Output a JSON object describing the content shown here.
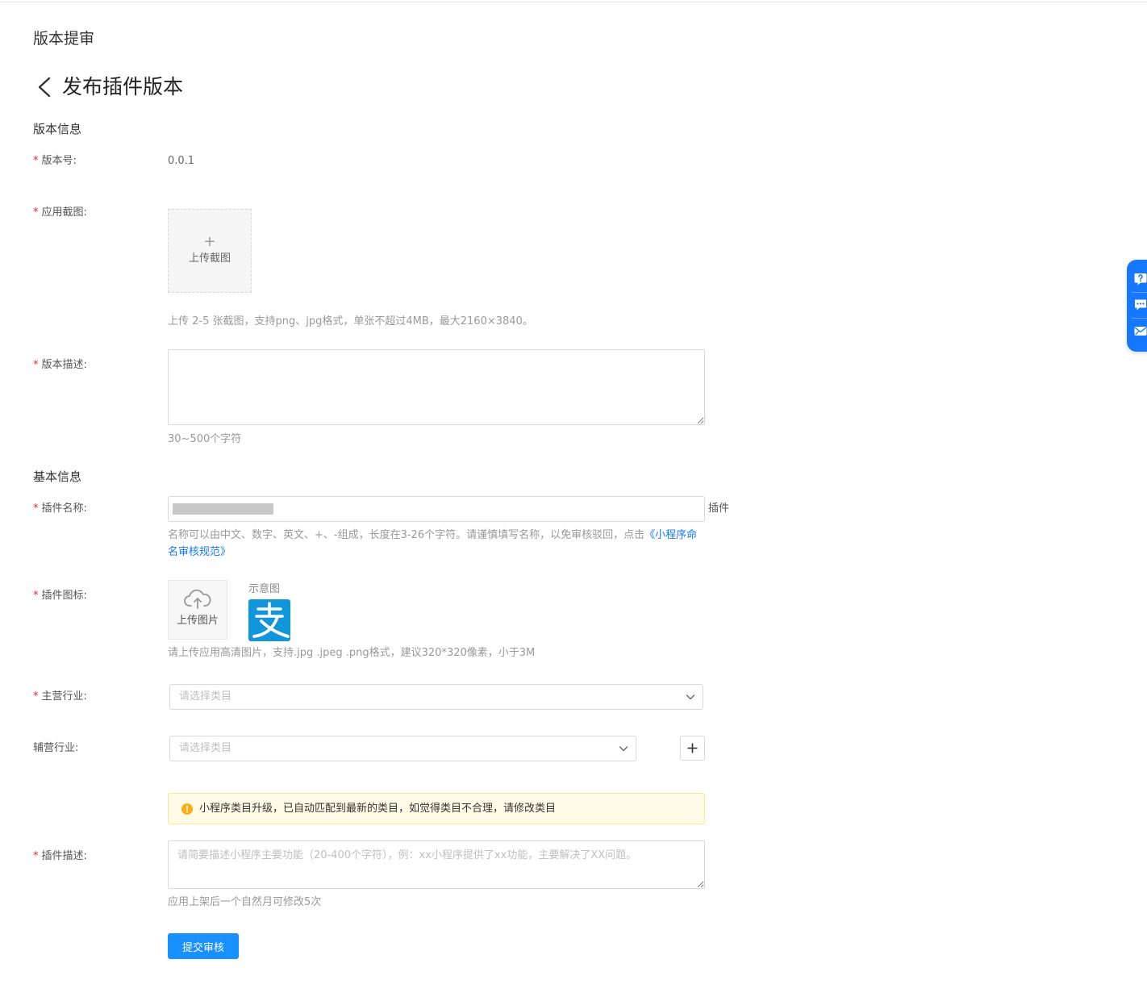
{
  "page": {
    "title": "版本提审",
    "subtitle": "发布插件版本"
  },
  "version_info": {
    "section_title": "版本信息",
    "version_label": "版本号:",
    "version_value": "0.0.1",
    "screenshot_label": "应用截图:",
    "upload_screenshot_plus": "+",
    "upload_screenshot_text": "上传截图",
    "screenshot_hint": "上传 2-5 张截图，支持png、jpg格式，单张不超过4MB，最大2160×3840。",
    "desc_label": "版本描述:",
    "desc_value": "",
    "desc_hint": "30~500个字符"
  },
  "basic_info": {
    "section_title": "基本信息",
    "name_label": "插件名称:",
    "name_suffix": "插件",
    "name_hint": "名称可以由中文、数字、英文、+、-组成，长度在3-26个字符。请谨慎填写名称，以免审核驳回，点击",
    "name_hint_link": "《小程序命名审核规范》",
    "icon_label": "插件图标:",
    "icon_upload_text": "上传图片",
    "icon_sample_label": "示意图",
    "icon_hint": "请上传应用高清图片，支持.jpg .jpeg .png格式，建议320*320像素，小于3M",
    "main_industry_label": "主营行业:",
    "main_industry_placeholder": "请选择类目",
    "sub_industry_label": "辅营行业:",
    "sub_industry_placeholder": "请选择类目",
    "alert_text": "小程序类目升级，已自动匹配到最新的类目，如觉得类目不合理，请修改类目",
    "plugin_desc_label": "插件描述:",
    "plugin_desc_placeholder": "请简要描述小程序主要功能（20-400个字符），例：xx小程序提供了xx功能，主要解决了XX问题。",
    "plugin_desc_hint": "应用上架后一个自然月可修改5次"
  },
  "actions": {
    "submit_label": "提交审核"
  },
  "colors": {
    "primary": "#1890ff",
    "required_star": "#f5222d",
    "alert_bg": "#fffbe6",
    "alert_border": "#ffe58f",
    "warning_icon": "#faad14",
    "alipay_blue": "#1296db"
  },
  "icons": {
    "back": "chevron-left-icon",
    "upload": "cloud-upload-icon",
    "dropdown": "chevron-down-icon",
    "add": "plus-icon",
    "warning": "exclamation-circle-icon",
    "float_help": "question-icon",
    "float_chat": "chat-icon",
    "float_mail": "mail-icon"
  }
}
